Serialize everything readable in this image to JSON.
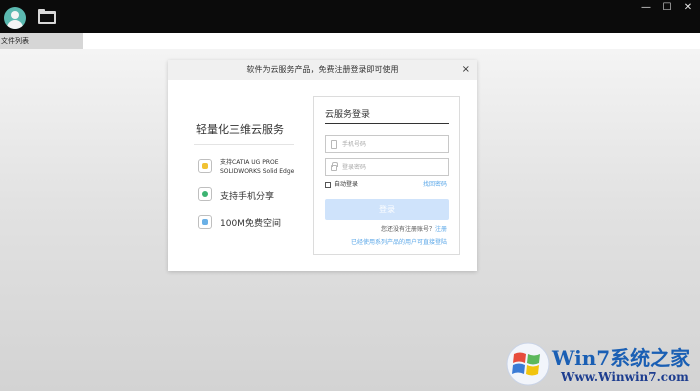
{
  "titlebar": {
    "minimize": "—",
    "maximize": "☐",
    "close": "✕"
  },
  "tabbar": {
    "tab_label": "文件列表"
  },
  "dialog": {
    "title": "软件为云服务产品，免费注册登录即可使用",
    "close": "×",
    "left": {
      "title": "轻量化三维云服务",
      "features": [
        {
          "line1": "支持CATIA UG PROE",
          "line2": "SOLIDWORKS Solid Edge"
        },
        {
          "text": "支持手机分享"
        },
        {
          "text": "100M免费空间"
        }
      ]
    },
    "login": {
      "title": "云服务登录",
      "phone_placeholder": "手机号码",
      "password_placeholder": "登录密码",
      "auto_login": "自动登录",
      "forgot": "找回密码",
      "button": "登录",
      "no_account": "您还没有注册账号？",
      "register": "注册",
      "old_app": "已经使用系列产品的用户可直接登陆"
    }
  },
  "watermark": {
    "title": "Win7系统之家",
    "url": "Www.Winwin7.com"
  }
}
